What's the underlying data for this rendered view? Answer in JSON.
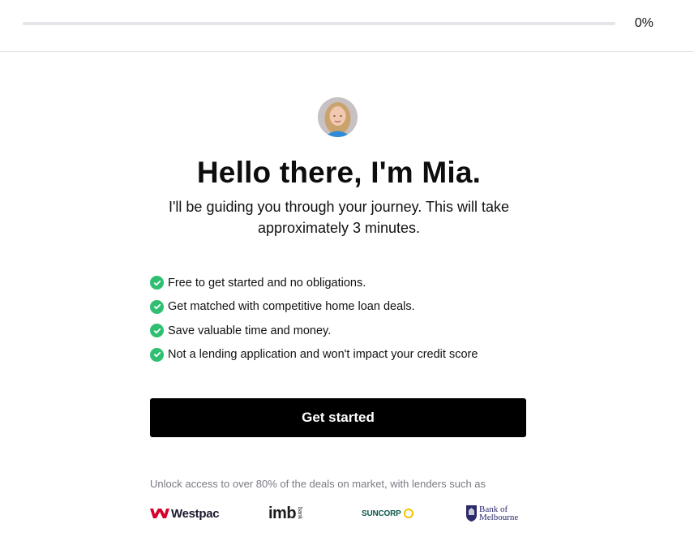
{
  "progress": {
    "percent_label": "0%",
    "value": 0
  },
  "intro": {
    "greeting": "Hello there, I'm Mia.",
    "subtitle": "I'll be guiding you through your journey. This will take approximately 3 minutes."
  },
  "features": [
    {
      "label": "Free to get started and no obligations.",
      "icon": "check-circle-icon"
    },
    {
      "label": "Get matched with competitive home loan deals.",
      "icon": "check-circle-icon"
    },
    {
      "label": "Save valuable time and money.",
      "icon": "check-circle-icon"
    },
    {
      "label": "Not a lending application and won't impact your credit score",
      "icon": "check-circle-icon"
    }
  ],
  "cta": {
    "label": "Get started"
  },
  "lenders": {
    "note": "Unlock access to over 80% of the deals on market, with lenders such as",
    "logos": {
      "westpac": "Westpac",
      "imb": "imb",
      "imb_small": "bank",
      "suncorp": "SUNCORP",
      "bom_line1": "Bank of",
      "bom_line2": "Melbourne"
    }
  },
  "colors": {
    "accent_check": "#2fbf71",
    "cta_bg": "#000000",
    "westpac_red": "#d5002b",
    "imb_green": "#2aa84a",
    "suncorp_yellow": "#f2c500",
    "bom_navy": "#2b2a6b"
  }
}
